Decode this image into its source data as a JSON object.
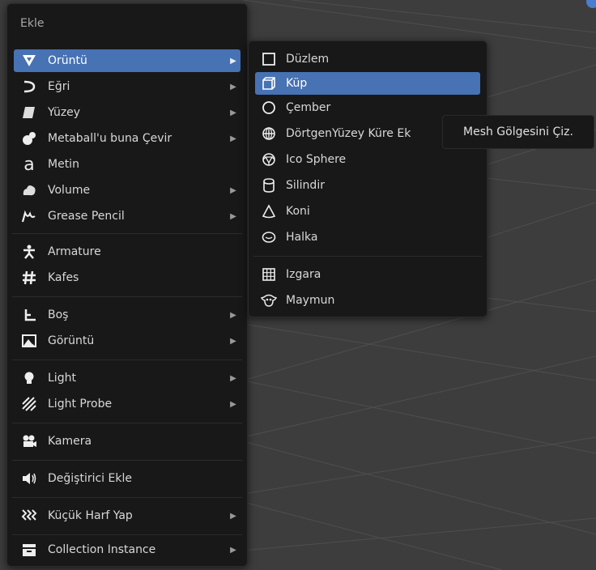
{
  "menu": {
    "title": "Ekle",
    "items": [
      {
        "label": "Örüntü",
        "icon": "mesh-triangle-icon",
        "has_submenu": true,
        "active": true
      },
      {
        "label": "Eğri",
        "icon": "curve-icon",
        "has_submenu": true
      },
      {
        "label": "Yüzey",
        "icon": "surface-icon",
        "has_submenu": true
      },
      {
        "label": "Metaball'u buna Çevir",
        "icon": "metaball-icon",
        "has_submenu": true
      },
      {
        "label": "Metin",
        "icon": "text-icon",
        "has_submenu": false
      },
      {
        "label": "Volume",
        "icon": "volume-icon",
        "has_submenu": true
      },
      {
        "label": "Grease Pencil",
        "icon": "grease-pencil-icon",
        "has_submenu": true
      },
      {
        "label": "Armature",
        "icon": "armature-icon",
        "has_submenu": false
      },
      {
        "label": "Kafes",
        "icon": "lattice-icon",
        "has_submenu": false
      },
      {
        "label": "Boş",
        "icon": "empty-icon",
        "has_submenu": true
      },
      {
        "label": "Görüntü",
        "icon": "image-icon",
        "has_submenu": true
      },
      {
        "label": "Light",
        "icon": "light-icon",
        "has_submenu": true
      },
      {
        "label": "Light Probe",
        "icon": "light-probe-icon",
        "has_submenu": true
      },
      {
        "label": "Kamera",
        "icon": "camera-icon",
        "has_submenu": false
      },
      {
        "label": "Değiştirici Ekle",
        "icon": "speaker-icon",
        "has_submenu": false
      },
      {
        "label": "Küçük Harf Yap",
        "icon": "force-field-icon",
        "has_submenu": true
      },
      {
        "label": "Collection Instance",
        "icon": "collection-icon",
        "has_submenu": true
      }
    ]
  },
  "submenu": {
    "items": [
      {
        "label": "Düzlem",
        "icon": "plane-icon"
      },
      {
        "label": "Küp",
        "icon": "cube-icon",
        "active": true
      },
      {
        "label": "Çember",
        "icon": "circle-icon"
      },
      {
        "label": "DörtgenYüzey Küre Ek",
        "icon": "uv-sphere-icon"
      },
      {
        "label": "Ico Sphere",
        "icon": "ico-sphere-icon"
      },
      {
        "label": "Silindir",
        "icon": "cylinder-icon"
      },
      {
        "label": "Koni",
        "icon": "cone-icon"
      },
      {
        "label": "Halka",
        "icon": "torus-icon"
      },
      {
        "label": "Izgara",
        "icon": "grid-icon"
      },
      {
        "label": "Maymun",
        "icon": "monkey-icon"
      }
    ]
  },
  "tooltip": {
    "text": "Mesh Gölgesini Çiz."
  },
  "colors": {
    "menu_bg": "#181818",
    "highlight": "#4772b3",
    "viewport_bg": "#3d3d3d",
    "grid_line": "#4e4e4e"
  }
}
